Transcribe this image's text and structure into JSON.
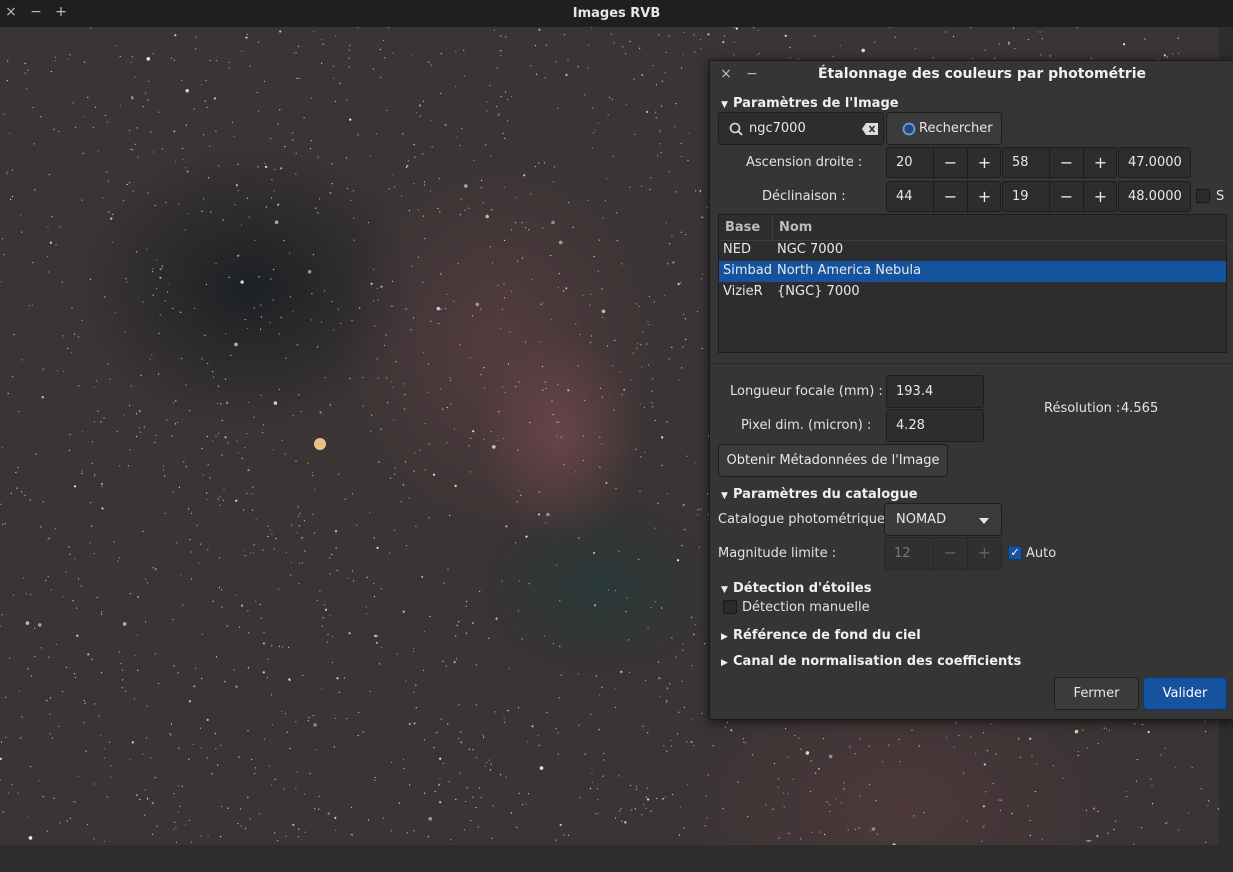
{
  "main_window": {
    "title": "Images RVB",
    "controls": {
      "close": "×",
      "minimize": "−",
      "maximize": "+"
    }
  },
  "dialog": {
    "title": "Étalonnage des couleurs par photométrie",
    "controls": {
      "close": "×",
      "minimize": "−"
    },
    "image_params": {
      "section_label": "Paramètres de l'Image",
      "search_value": "ngc7000",
      "search_button": "Rechercher",
      "ra_label": "Ascension droite :",
      "ra_h": "20",
      "ra_m": "58",
      "ra_s": "47.0000",
      "dec_label": "Déclinaison :",
      "dec_d": "44",
      "dec_m": "19",
      "dec_s": "48.0000",
      "south_label": "S",
      "table": {
        "headers": [
          "Base",
          "Nom"
        ],
        "rows": [
          {
            "base": "NED",
            "name": "NGC 7000",
            "selected": false
          },
          {
            "base": "Simbad",
            "name": "North America Nebula",
            "selected": true
          },
          {
            "base": "VizieR",
            "name": "{NGC} 7000",
            "selected": false
          }
        ]
      },
      "focal_label": "Longueur focale (mm) :",
      "focal_value": "193.4",
      "pixel_label": "Pixel dim. (micron) :",
      "pixel_value": "4.28",
      "resolution_label": "Résolution :",
      "resolution_value": "4.565",
      "metadata_button": "Obtenir Métadonnées de l'Image"
    },
    "catalog_params": {
      "section_label": "Paramètres du catalogue",
      "catalog_label": "Catalogue photométrique :",
      "catalog_value": "NOMAD",
      "magnitude_label": "Magnitude limite :",
      "magnitude_value": "12",
      "auto_label": "Auto",
      "auto_checked": true
    },
    "star_detection": {
      "section_label": "Détection d'étoiles",
      "manual_label": "Détection manuelle",
      "manual_checked": false
    },
    "sky_background": {
      "section_label": "Référence de fond du ciel"
    },
    "normalization": {
      "section_label": "Canal de normalisation des coefficients"
    },
    "buttons": {
      "close": "Fermer",
      "apply": "Valider"
    }
  },
  "colors": {
    "accent": "#15539e",
    "dialog_bg": "#353535",
    "field_bg": "#2d2d2d"
  }
}
